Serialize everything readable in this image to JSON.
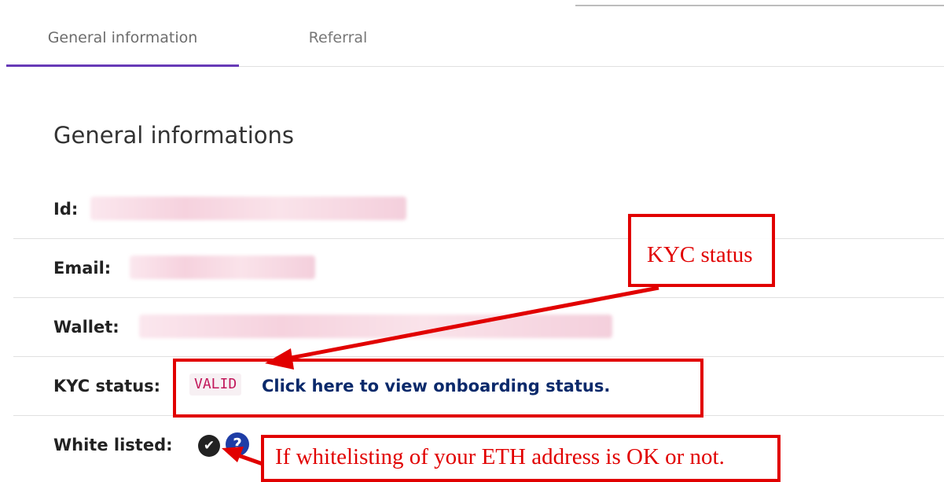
{
  "tabs": [
    {
      "label": "General information",
      "active": true
    },
    {
      "label": "Referral",
      "active": false
    }
  ],
  "section": {
    "title": "General informations"
  },
  "fields": {
    "id_label": "Id:",
    "email_label": "Email:",
    "wallet_label": "Wallet:",
    "kyc_label": "KYC status:",
    "kyc_value": "VALID",
    "kyc_link": "Click here to view onboarding status.",
    "white_label": "White listed:",
    "white_check_icon": "check-circle-icon",
    "help_icon": "question-circle-icon",
    "help_glyph": "?"
  },
  "annotations": {
    "kyc_note": "KYC status",
    "white_note": "If whitelisting of your ETH address is OK or not.",
    "color": "#e10000"
  },
  "colors": {
    "tab_indicator": "#673ab7",
    "link": "#0b2a6b",
    "badge_text": "#c2185b",
    "help_icon_bg": "#1e3da6"
  }
}
